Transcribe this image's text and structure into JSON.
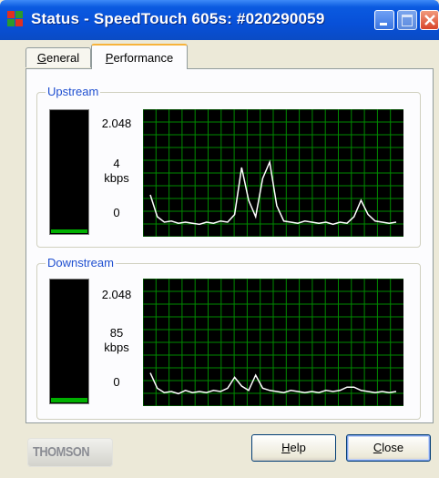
{
  "window": {
    "title": "Status - SpeedTouch 605s: #020290059"
  },
  "tabs": [
    {
      "label_accel": "G",
      "label_rest": "eneral",
      "active": false
    },
    {
      "label_accel": "P",
      "label_rest": "erformance",
      "active": true
    }
  ],
  "upstream": {
    "label": "Upstream",
    "scale_max": "2.048",
    "current_value": "4",
    "unit": "kbps",
    "scale_min": "0",
    "meter_level_fraction": 0.002,
    "history": [
      30,
      10,
      5,
      6,
      4,
      5,
      4,
      3,
      5,
      4,
      6,
      5,
      12,
      55,
      25,
      10,
      45,
      60,
      20,
      6,
      5,
      4,
      6,
      5,
      4,
      5,
      3,
      5,
      4,
      10,
      25,
      12,
      6,
      5,
      4,
      5
    ]
  },
  "downstream": {
    "label": "Downstream",
    "scale_max": "2.048",
    "current_value": "85",
    "unit": "kbps",
    "scale_min": "0",
    "meter_level_fraction": 0.04,
    "history": [
      22,
      8,
      4,
      5,
      3,
      6,
      4,
      5,
      4,
      6,
      5,
      8,
      18,
      10,
      6,
      20,
      8,
      6,
      5,
      4,
      6,
      5,
      4,
      5,
      4,
      6,
      5,
      6,
      9,
      9,
      6,
      5,
      4,
      5,
      4,
      5
    ]
  },
  "colors": {
    "graph_grid": "#008a00",
    "graph_line": "#ffffff",
    "meter_fill": "#00b000"
  },
  "buttons": {
    "help": {
      "accel": "H",
      "rest": "elp"
    },
    "close": {
      "accel": "C",
      "rest": "lose"
    }
  },
  "logo": {
    "text": "THOMSON"
  }
}
